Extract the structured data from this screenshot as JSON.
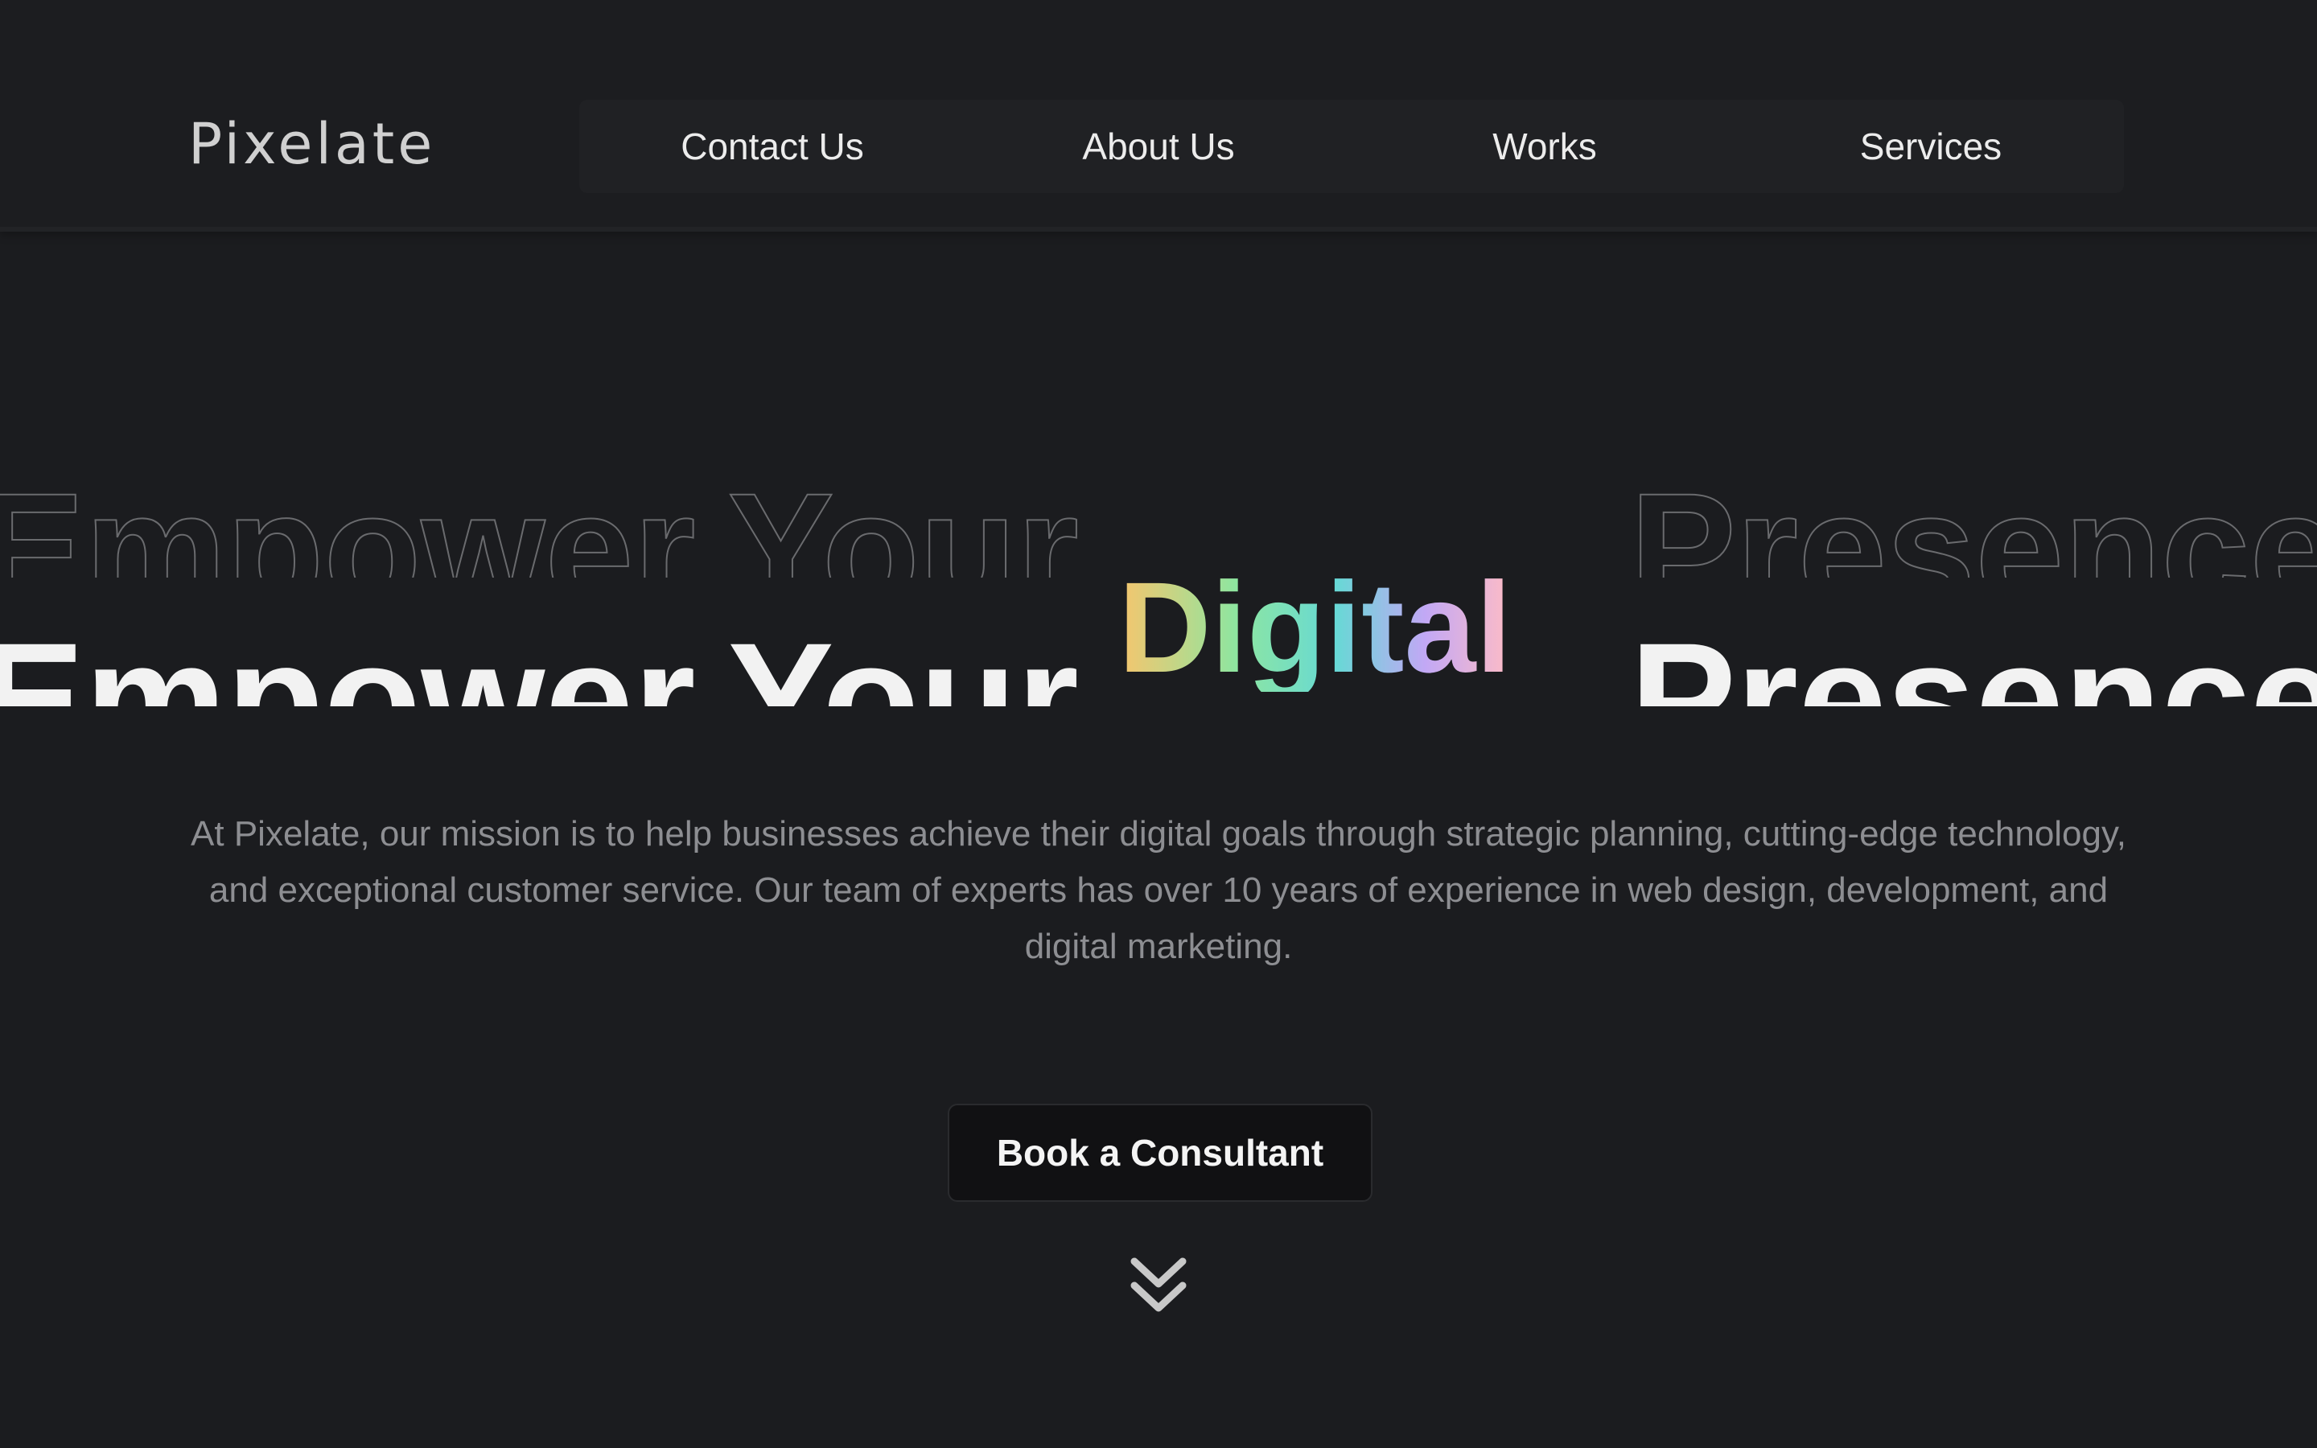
{
  "header": {
    "logo": "Pixelate",
    "nav": [
      "Contact Us",
      "About Us",
      "Works",
      "Services"
    ]
  },
  "hero": {
    "word1": "Empower",
    "word2": "Your",
    "highlight": "Digital",
    "word3": "Presence",
    "description": "At Pixelate, our mission is to help businesses achieve their digital goals through strategic planning, cutting-edge technology, and exceptional customer service. Our team of experts has over 10 years of experience in web design, development, and digital marketing.",
    "cta_label": "Book a Consultant",
    "scroll_icon": "double-chevron-down-icon"
  },
  "colors": {
    "background": "#1b1c1f",
    "gradient": [
      "#f7c56d",
      "#8ee6a0",
      "#66d9d5",
      "#c2a8f5",
      "#ffbcc5"
    ]
  }
}
